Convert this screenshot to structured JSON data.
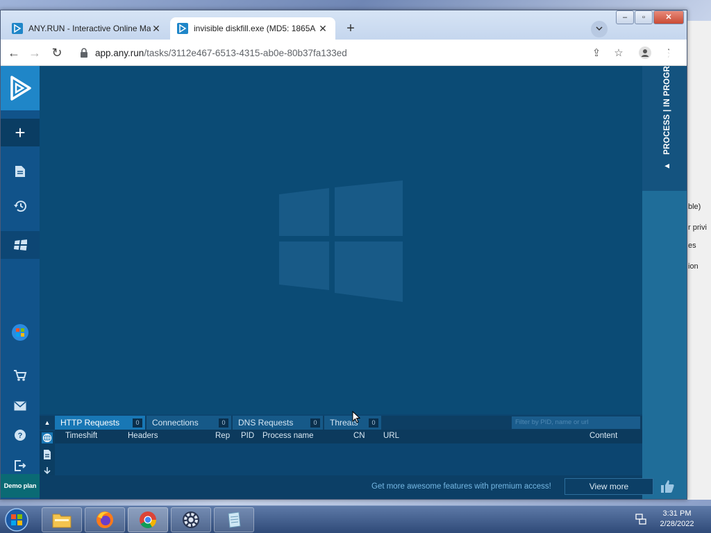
{
  "browser": {
    "tabs": [
      {
        "title": "ANY.RUN - Interactive Online Ma",
        "active": false
      },
      {
        "title": "invisible diskfill.exe (MD5: 1865A",
        "active": true
      }
    ],
    "url_host": "app.any.run",
    "url_path": "/tasks/3112e467-6513-4315-ab0e-80b37fa133ed"
  },
  "sidebar": {
    "demo_plan": "Demo plan"
  },
  "right_panel": {
    "label": "PROCESS | IN PROGRESS"
  },
  "network": {
    "tabs": [
      {
        "label": "HTTP Requests",
        "count": "0"
      },
      {
        "label": "Connections",
        "count": "0"
      },
      {
        "label": "DNS Requests",
        "count": "0"
      },
      {
        "label": "Threats",
        "count": "0"
      }
    ],
    "filter_placeholder": "Filter by PID, name or url",
    "columns": [
      "Timeshift",
      "Headers",
      "Rep",
      "PID",
      "Process name",
      "CN",
      "URL",
      "Content"
    ]
  },
  "footer": {
    "promo": "Get more awesome features with premium access!",
    "view_more": "View more"
  },
  "background_window": {
    "texts": [
      "ble)",
      "r privi",
      "es",
      "ion"
    ]
  },
  "taskbar": {
    "time": "3:31 PM",
    "date": "2/28/2022"
  },
  "colors": {
    "app_bg": "#0d4a74",
    "sidebar": "#11538a",
    "accent": "#1877b5"
  }
}
